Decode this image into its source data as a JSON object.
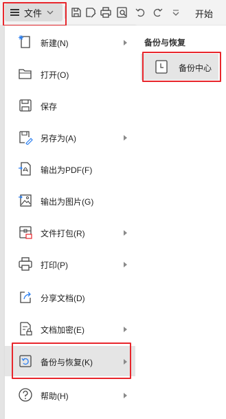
{
  "toolbar": {
    "file_label": "文件",
    "start_tab": "开始",
    "icons": [
      "save-icon",
      "save-as-icon",
      "print-icon",
      "print-preview-icon",
      "undo-icon",
      "redo-icon",
      "dropdown-icon"
    ]
  },
  "menu": {
    "items": [
      {
        "label": "新建(N)",
        "icon": "new-document-icon",
        "has_submenu": true
      },
      {
        "label": "打开(O)",
        "icon": "folder-open-icon",
        "has_submenu": false
      },
      {
        "label": "保存",
        "icon": "save-icon",
        "has_submenu": false
      },
      {
        "label": "另存为(A)",
        "icon": "save-as-icon",
        "has_submenu": true
      },
      {
        "label": "输出为PDF(F)",
        "icon": "pdf-export-icon",
        "has_submenu": false
      },
      {
        "label": "输出为图片(G)",
        "icon": "image-export-icon",
        "has_submenu": false
      },
      {
        "label": "文件打包(R)",
        "icon": "package-icon",
        "has_submenu": true
      },
      {
        "label": "打印(P)",
        "icon": "print-icon",
        "has_submenu": true
      },
      {
        "label": "分享文档(D)",
        "icon": "share-icon",
        "has_submenu": false
      },
      {
        "label": "文档加密(E)",
        "icon": "encrypt-icon",
        "has_submenu": true
      },
      {
        "label": "备份与恢复(K)",
        "icon": "backup-restore-icon",
        "has_submenu": true,
        "active": true
      },
      {
        "label": "帮助(H)",
        "icon": "help-icon",
        "has_submenu": true
      }
    ]
  },
  "submenu": {
    "title": "备份与恢复",
    "item_label": "备份中心"
  },
  "colors": {
    "highlight_border": "#e8262c",
    "active_background": "#e5e5e5",
    "toolbar_background": "#f3f3f3"
  }
}
